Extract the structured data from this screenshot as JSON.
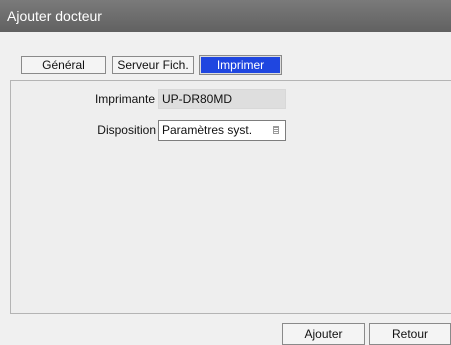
{
  "window": {
    "title": "Ajouter docteur"
  },
  "tabs": [
    {
      "label": "Général"
    },
    {
      "label": "Serveur Fich."
    },
    {
      "label": "Imprimer",
      "active": true
    }
  ],
  "form": {
    "printer_label": "Imprimante",
    "printer_value": "UP-DR80MD",
    "layout_label": "Disposition",
    "layout_value": "Paramètres syst.",
    "layout_icon": "list-icon"
  },
  "buttons": {
    "add_label": "Ajouter",
    "back_label": "Retour"
  },
  "colors": {
    "titlebar": "#6e6e6e",
    "active_tab": "#1f46e0"
  }
}
